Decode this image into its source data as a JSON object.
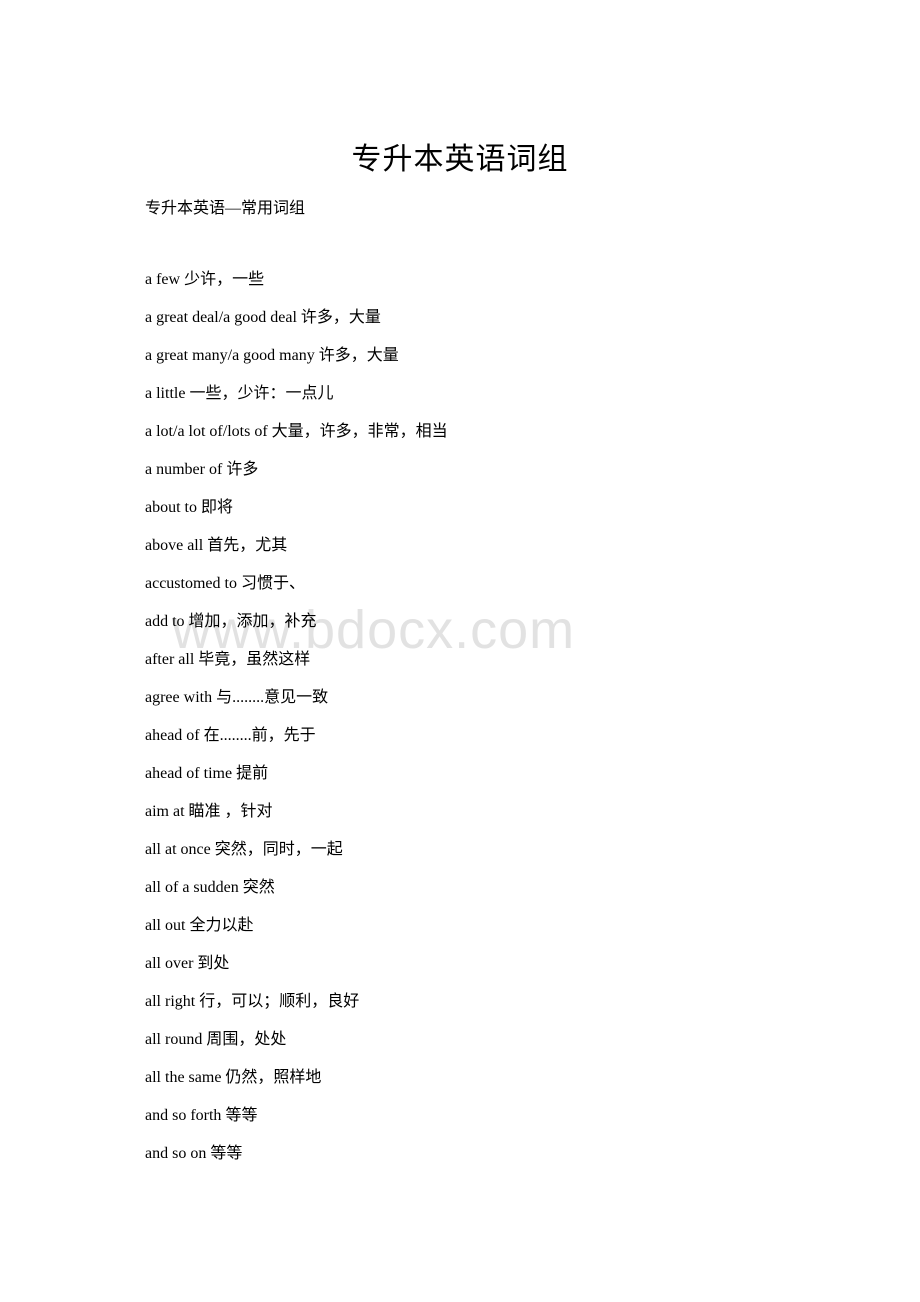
{
  "document": {
    "title": "专升本英语词组",
    "subtitle": "专升本英语—常用词组",
    "watermark": "www.bdocx.com",
    "watermark_color": "#e2e2e2",
    "background_color": "#ffffff",
    "text_color": "#000000"
  },
  "phrases": [
    {
      "en": "a few",
      "cn": "少许，一些"
    },
    {
      "en": "a great deal/a good deal",
      "cn": "许多，大量"
    },
    {
      "en": "a great many/a good many",
      "cn": "许多，大量"
    },
    {
      "en": "a little",
      "cn": "一些，少许：一点儿"
    },
    {
      "en": "a lot/a lot of/lots of",
      "cn": "大量，许多，非常，相当"
    },
    {
      "en": "a number of",
      "cn": "许多"
    },
    {
      "en": "about to",
      "cn": "即将"
    },
    {
      "en": "above all",
      "cn": "首先，尤其"
    },
    {
      "en": "accustomed to",
      "cn": "习惯于、"
    },
    {
      "en": "add to",
      "cn": "增加，添加，补充"
    },
    {
      "en": "after all",
      "cn": "毕竟，虽然这样"
    },
    {
      "en": "agree with",
      "cn": "与........意见一致"
    },
    {
      "en": "ahead of",
      "cn": "在........前，先于"
    },
    {
      "en": "ahead of time",
      "cn": "提前"
    },
    {
      "en": "aim at",
      "cn": "瞄准 ，针对"
    },
    {
      "en": "all at once",
      "cn": "突然，同时，一起"
    },
    {
      "en": "all of a sudden",
      "cn": "突然"
    },
    {
      "en": "all out",
      "cn": "全力以赴"
    },
    {
      "en": "all over",
      "cn": "到处"
    },
    {
      "en": "all right",
      "cn": "行，可以；顺利，良好"
    },
    {
      "en": "all round",
      "cn": "周围，处处"
    },
    {
      "en": "all the same",
      "cn": "仍然，照样地"
    },
    {
      "en": "and so forth",
      "cn": "等等"
    },
    {
      "en": "and so on",
      "cn": "等等"
    }
  ]
}
